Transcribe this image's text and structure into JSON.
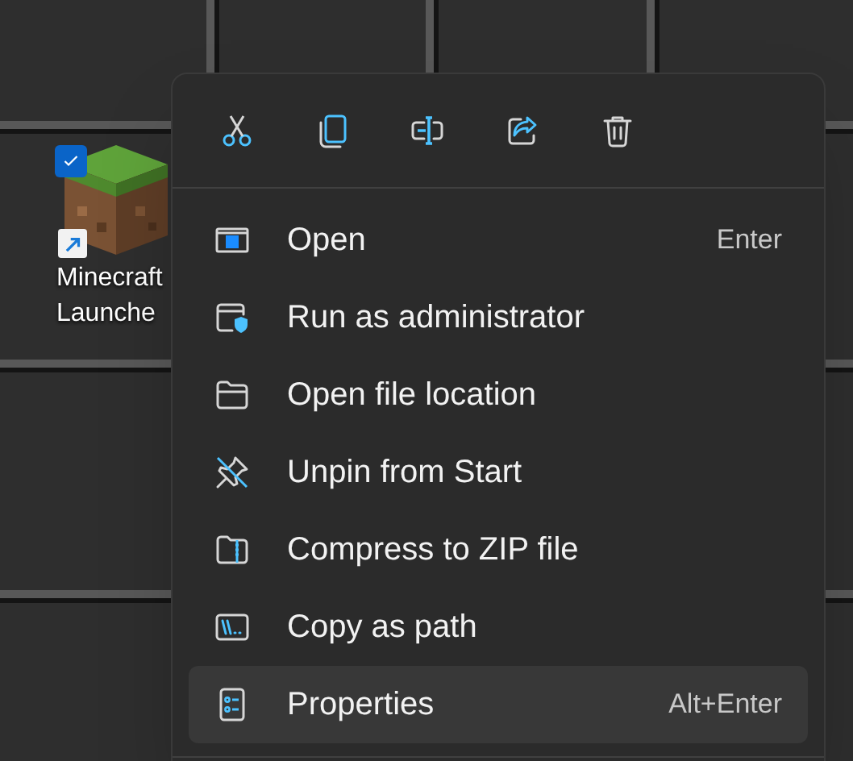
{
  "desktop_icon": {
    "label_lines": [
      "Minecraft",
      "Launche"
    ],
    "checked": true,
    "shortcut": true
  },
  "toolbar": [
    {
      "kind": "cut"
    },
    {
      "kind": "copy"
    },
    {
      "kind": "rename"
    },
    {
      "kind": "share"
    },
    {
      "kind": "delete"
    }
  ],
  "menu_items": [
    {
      "kind": "open",
      "label": "Open",
      "shortcut": "Enter",
      "selected": false
    },
    {
      "kind": "admin",
      "label": "Run as administrator",
      "selected": false
    },
    {
      "kind": "folder",
      "label": "Open file location",
      "selected": false
    },
    {
      "kind": "unpin",
      "label": "Unpin from Start",
      "selected": false
    },
    {
      "kind": "zip",
      "label": "Compress to ZIP file",
      "selected": false
    },
    {
      "kind": "path",
      "label": "Copy as path",
      "selected": false
    },
    {
      "kind": "properties",
      "label": "Properties",
      "shortcut": "Alt+Enter",
      "selected": true
    }
  ]
}
